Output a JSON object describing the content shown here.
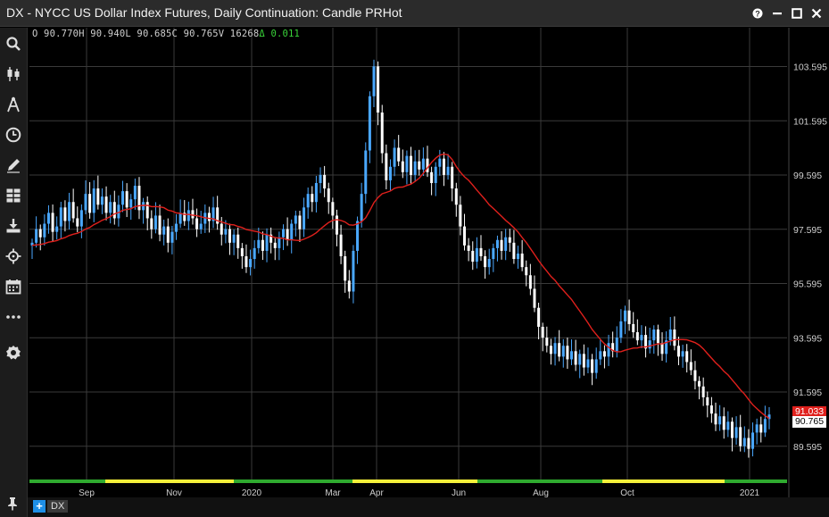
{
  "window": {
    "title": "DX - NYCC US Dollar Index Futures, Daily Continuation: Candle PRHot",
    "controls": [
      "help-icon",
      "minimize-icon",
      "maximize-icon",
      "close-icon"
    ]
  },
  "toolbar": {
    "icons": [
      "search-icon",
      "candlestick-icon",
      "drawing-tools-icon",
      "clock-icon",
      "pen-icon",
      "layout-grid-icon",
      "download-icon",
      "crosshair-icon",
      "calendar-icon",
      "more-icon",
      "settings-icon"
    ]
  },
  "ohlc": {
    "open": "O 90.770H",
    "high": "90.940L",
    "low": "90.685C",
    "close": "90.765V",
    "volume": "16268",
    "change": "Δ 0.011"
  },
  "price_tags": {
    "ma": "91.033",
    "last": "90.765"
  },
  "bottom": {
    "add_label": "+",
    "symbol": "DX"
  },
  "colors": {
    "up": "#4aa8ff",
    "down": "#ffffff",
    "ma": "#e0201c",
    "grid": "#3a3a3a",
    "session_green": "#2faa2f",
    "session_yellow": "#f5f03a",
    "bg": "#000000"
  },
  "chart_data": {
    "type": "candlestick",
    "y_ticks": [
      "103.595",
      "101.595",
      "99.595",
      "97.595",
      "95.595",
      "93.595",
      "91.595",
      "89.595"
    ],
    "x_ticks": [
      "Sep",
      "Nov",
      "2020",
      "Mar",
      "Apr",
      "Jun",
      "Aug",
      "Oct",
      "2021"
    ],
    "ylim": [
      88.6,
      104.6
    ],
    "closes": [
      97.1,
      97.6,
      97.3,
      97.8,
      98.2,
      97.5,
      97.7,
      98.4,
      97.9,
      98.6,
      98.0,
      97.7,
      98.3,
      98.9,
      98.2,
      99.1,
      98.5,
      98.8,
      98.2,
      98.6,
      98.0,
      98.5,
      99.0,
      98.4,
      98.7,
      99.2,
      98.3,
      98.6,
      98.0,
      97.6,
      98.1,
      97.4,
      97.7,
      97.1,
      97.5,
      97.8,
      98.2,
      97.9,
      98.3,
      98.0,
      97.6,
      97.8,
      98.2,
      97.9,
      98.4,
      97.8,
      97.4,
      97.6,
      97.1,
      97.4,
      96.9,
      96.6,
      96.2,
      96.5,
      96.9,
      97.2,
      96.8,
      97.4,
      97.1,
      96.9,
      97.3,
      97.6,
      97.2,
      97.8,
      98.1,
      97.6,
      98.4,
      98.9,
      98.6,
      99.3,
      99.6,
      99.1,
      98.6,
      98.1,
      97.4,
      96.6,
      95.7,
      95.3,
      96.8,
      97.9,
      98.9,
      100.5,
      102.5,
      103.6,
      101.9,
      100.4,
      99.4,
      99.9,
      100.6,
      100.1,
      99.7,
      100.3,
      99.6,
      100.1,
      99.8,
      100.2,
      99.7,
      99.3,
      99.9,
      100.2,
      99.6,
      99.9,
      99.1,
      98.5,
      97.7,
      97.0,
      96.8,
      96.4,
      96.9,
      96.6,
      96.2,
      96.5,
      96.9,
      97.2,
      96.8,
      97.3,
      97.1,
      96.5,
      96.7,
      96.2,
      95.9,
      95.4,
      94.7,
      94.0,
      93.6,
      93.3,
      93.0,
      93.4,
      92.9,
      93.3,
      92.8,
      93.1,
      92.6,
      93.0,
      92.5,
      92.8,
      92.3,
      92.8,
      93.1,
      92.9,
      93.4,
      93.1,
      93.6,
      94.2,
      94.6,
      94.1,
      93.8,
      93.5,
      93.7,
      93.2,
      93.5,
      93.9,
      93.4,
      93.0,
      93.5,
      93.9,
      93.3,
      92.9,
      93.1,
      92.7,
      92.4,
      92.0,
      91.8,
      91.4,
      91.1,
      90.8,
      90.4,
      90.7,
      90.2,
      90.5,
      89.9,
      90.3,
      89.6,
      89.9,
      89.5,
      90.1,
      90.4,
      90.1,
      90.6,
      90.765
    ],
    "ma_series": "50-day moving average (red line)"
  }
}
